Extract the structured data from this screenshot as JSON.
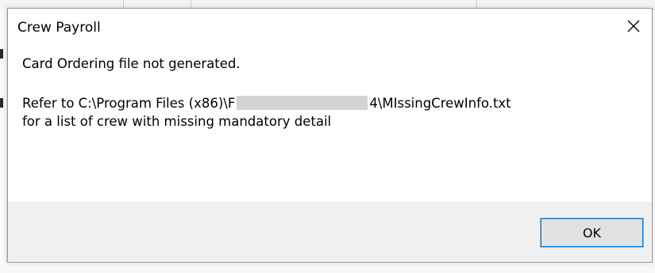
{
  "dialog": {
    "title": "Crew Payroll",
    "close_icon": "close-icon",
    "message": {
      "line1": "Card Ordering file not generated.",
      "line2_prefix": "Refer to C:\\Program Files (x86)\\F",
      "line2_suffix": "4\\MIssingCrewInfo.txt",
      "line3": "for a list of crew with missing mandatory detail"
    },
    "ok_label": "OK"
  },
  "colors": {
    "footer_bg": "#f0f0f0",
    "button_bg": "#e1e1e1",
    "focus_accent": "#0078d7"
  }
}
